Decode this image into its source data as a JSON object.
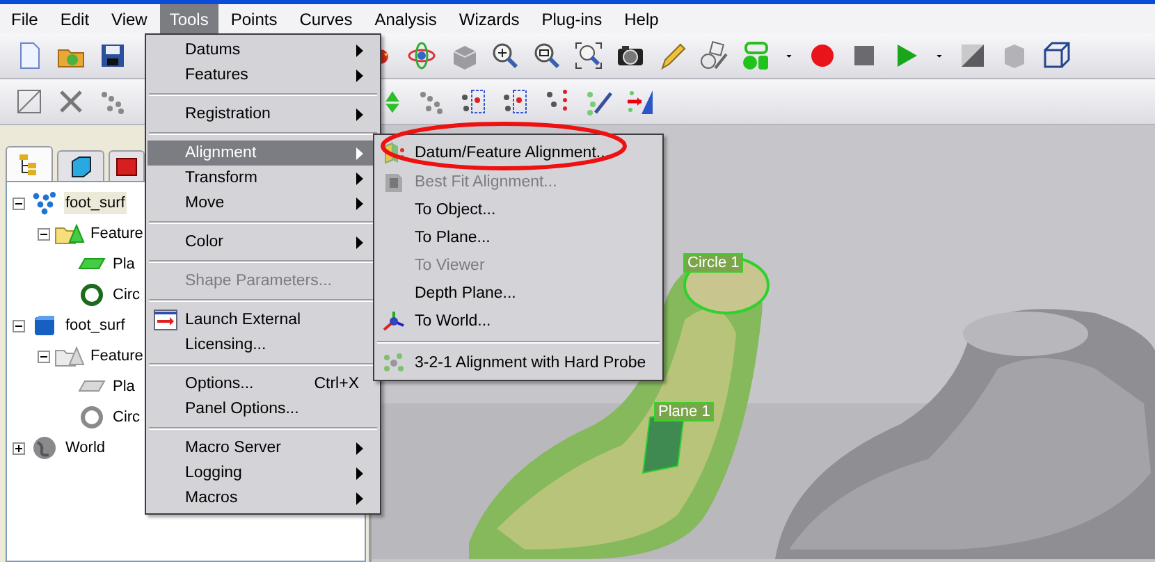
{
  "menu_bar": [
    {
      "label": "File",
      "selected": false
    },
    {
      "label": "Edit",
      "selected": false
    },
    {
      "label": "View",
      "selected": false
    },
    {
      "label": "Tools",
      "selected": true
    },
    {
      "label": "Points",
      "selected": false
    },
    {
      "label": "Curves",
      "selected": false
    },
    {
      "label": "Analysis",
      "selected": false
    },
    {
      "label": "Wizards",
      "selected": false
    },
    {
      "label": "Plug-ins",
      "selected": false
    },
    {
      "label": "Help",
      "selected": false
    }
  ],
  "tree_tabs": [
    {
      "selected": true
    },
    {
      "selected": false
    },
    {
      "selected": false
    }
  ],
  "tree": [
    {
      "kind": "points",
      "label": "foot_surf",
      "selected": true,
      "expanded": true,
      "children": [
        {
          "kind": "features",
          "label": "Feature",
          "selected": false,
          "expanded": true,
          "active": true,
          "children": [
            {
              "kind": "plane",
              "label": "Pla",
              "selected": false,
              "active": true
            },
            {
              "kind": "circle",
              "label": "Circ",
              "selected": false,
              "active": true
            }
          ]
        }
      ]
    },
    {
      "kind": "mesh",
      "label": "foot_surf",
      "selected": false,
      "expanded": true,
      "children": [
        {
          "kind": "features",
          "label": "Feature",
          "selected": false,
          "expanded": true,
          "active": false,
          "children": [
            {
              "kind": "plane",
              "label": "Pla",
              "selected": false,
              "active": false
            },
            {
              "kind": "circle",
              "label": "Circ",
              "selected": false,
              "active": false
            }
          ]
        }
      ]
    },
    {
      "kind": "world",
      "label": "World",
      "selected": false,
      "expanded": false
    }
  ],
  "tools_menu": [
    {
      "kind": "item",
      "label": "Datums",
      "submenu": true,
      "disabled": false,
      "selected": false
    },
    {
      "kind": "item",
      "label": "Features",
      "submenu": true,
      "disabled": false,
      "selected": false
    },
    {
      "kind": "separator"
    },
    {
      "kind": "item",
      "label": "Registration",
      "submenu": true,
      "disabled": false,
      "selected": false
    },
    {
      "kind": "separator"
    },
    {
      "kind": "item",
      "label": "Alignment",
      "submenu": true,
      "disabled": false,
      "selected": true
    },
    {
      "kind": "item",
      "label": "Transform",
      "submenu": true,
      "disabled": false,
      "selected": false
    },
    {
      "kind": "item",
      "label": "Move",
      "submenu": true,
      "disabled": false,
      "selected": false
    },
    {
      "kind": "separator"
    },
    {
      "kind": "item",
      "label": "Color",
      "submenu": true,
      "disabled": false,
      "selected": false
    },
    {
      "kind": "separator"
    },
    {
      "kind": "item",
      "label": "Shape Parameters...",
      "submenu": false,
      "disabled": true,
      "selected": false
    },
    {
      "kind": "separator"
    },
    {
      "kind": "item",
      "label": "Launch External",
      "submenu": false,
      "disabled": false,
      "selected": false
    },
    {
      "kind": "item",
      "label": "Licensing...",
      "submenu": false,
      "disabled": false,
      "selected": false
    },
    {
      "kind": "separator"
    },
    {
      "kind": "item",
      "label": "Options...",
      "shortcut": "Ctrl+X",
      "submenu": false,
      "disabled": false,
      "selected": false
    },
    {
      "kind": "item",
      "label": "Panel Options...",
      "submenu": false,
      "disabled": false,
      "selected": false
    },
    {
      "kind": "separator"
    },
    {
      "kind": "item",
      "label": "Macro Server",
      "submenu": true,
      "disabled": false,
      "selected": false
    },
    {
      "kind": "item",
      "label": "Logging",
      "submenu": true,
      "disabled": false,
      "selected": false
    },
    {
      "kind": "item",
      "label": "Macros",
      "submenu": true,
      "disabled": false,
      "selected": false
    }
  ],
  "alignment_submenu": [
    {
      "kind": "item",
      "label": "Datum/Feature Alignment...",
      "disabled": false,
      "selected": false
    },
    {
      "kind": "item",
      "label": "Best Fit Alignment...",
      "disabled": true,
      "selected": false
    },
    {
      "kind": "item",
      "label": "To Object...",
      "disabled": false,
      "selected": false
    },
    {
      "kind": "item",
      "label": "To Plane...",
      "disabled": false,
      "selected": false
    },
    {
      "kind": "item",
      "label": "To Viewer",
      "disabled": true,
      "selected": false
    },
    {
      "kind": "item",
      "label": "Depth Plane...",
      "disabled": false,
      "selected": false
    },
    {
      "kind": "item",
      "label": "To World...",
      "disabled": false,
      "selected": false
    },
    {
      "kind": "separator"
    },
    {
      "kind": "item",
      "label": "3-2-1 Alignment with Hard Probe",
      "disabled": false,
      "selected": false
    }
  ],
  "viewport": {
    "labels": [
      {
        "text": "Circle 1"
      },
      {
        "text": "Plane 1"
      }
    ]
  }
}
